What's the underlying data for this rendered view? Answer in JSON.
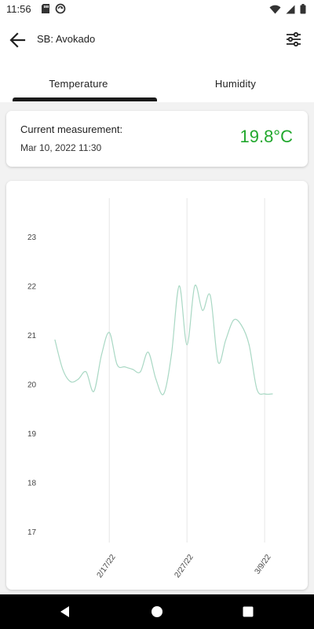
{
  "status_bar": {
    "time": "11:56",
    "left_icons": [
      "sd-card-icon",
      "sync-icon"
    ],
    "right_icons": [
      "wifi-icon",
      "signal-icon",
      "battery-icon"
    ]
  },
  "toolbar": {
    "title": "SB: Avokado",
    "back_icon": "arrow-left-icon",
    "filter_icon": "sliders-icon"
  },
  "tabs": [
    {
      "label": "Temperature",
      "selected": true
    },
    {
      "label": "Humidity",
      "selected": false
    }
  ],
  "measurement": {
    "label": "Current measurement:",
    "date": "Mar 10, 2022 11:30",
    "value": "19.8°C",
    "value_color": "#22a82e"
  },
  "chart_data": {
    "type": "line",
    "line_color": "#a9d8c4",
    "grid": "vertical",
    "ylim": [
      17,
      23
    ],
    "y_ticks": [
      "17",
      "18",
      "19",
      "20",
      "21",
      "22",
      "23"
    ],
    "x_ticks": [
      "2/17/22",
      "2/27/22",
      "3/9/22"
    ],
    "xlim": [
      "2/10/22",
      "3/10/22"
    ],
    "x": [
      "2/10/22",
      "2/11/22",
      "2/12/22",
      "2/13/22",
      "2/14/22",
      "2/15/22",
      "2/16/22",
      "2/17/22",
      "2/18/22",
      "2/19/22",
      "2/20/22",
      "2/21/22",
      "2/22/22",
      "2/23/22",
      "2/24/22",
      "2/25/22",
      "2/26/22",
      "2/27/22",
      "2/28/22",
      "3/1/22",
      "3/2/22",
      "3/3/22",
      "3/4/22",
      "3/5/22",
      "3/6/22",
      "3/7/22",
      "3/8/22",
      "3/9/22",
      "3/10/22"
    ],
    "values": [
      20.9,
      20.3,
      20.05,
      20.1,
      20.25,
      19.85,
      20.6,
      21.05,
      20.4,
      20.35,
      20.3,
      20.25,
      20.65,
      20.1,
      19.8,
      20.6,
      22.0,
      20.8,
      22.0,
      21.5,
      21.8,
      20.45,
      20.9,
      21.3,
      21.2,
      20.8,
      19.9,
      19.8,
      19.8
    ]
  },
  "nav_bar": {
    "icons": [
      "back-triangle-icon",
      "home-circle-icon",
      "recents-square-icon"
    ]
  }
}
